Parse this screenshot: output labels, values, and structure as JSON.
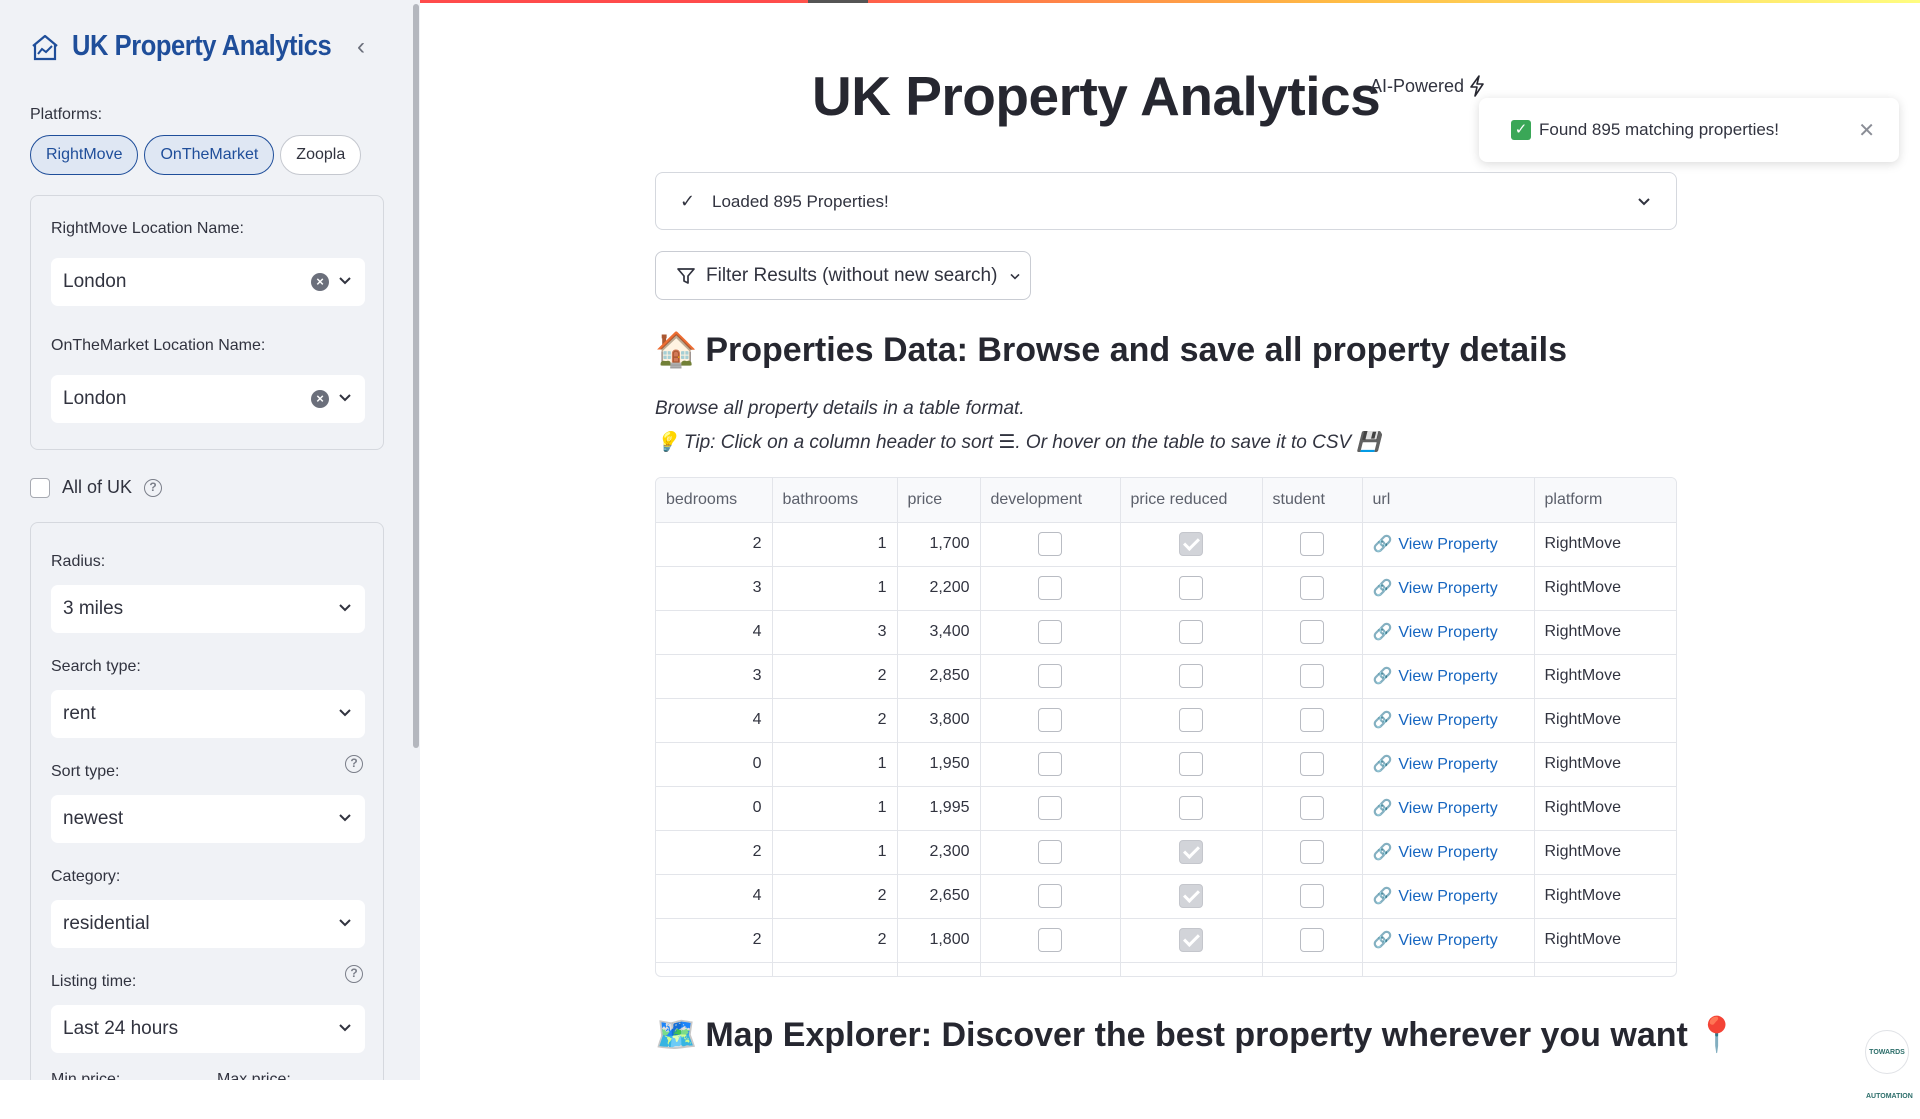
{
  "sidebar": {
    "brand_title": "UK Property Analytics",
    "platforms_label": "Platforms:",
    "platforms": [
      {
        "label": "RightMove",
        "selected": true
      },
      {
        "label": "OnTheMarket",
        "selected": true
      },
      {
        "label": "Zoopla",
        "selected": false
      }
    ],
    "rightmove_label": "RightMove Location Name:",
    "rightmove_value": "London",
    "onthemarket_label": "OnTheMarket Location Name:",
    "onthemarket_value": "London",
    "all_uk_label": "All of UK",
    "radius_label": "Radius:",
    "radius_value": "3 miles",
    "search_type_label": "Search type:",
    "search_type_value": "rent",
    "sort_type_label": "Sort type:",
    "sort_type_value": "newest",
    "category_label": "Category:",
    "category_value": "residential",
    "listing_time_label": "Listing time:",
    "listing_time_value": "Last 24 hours",
    "min_price_label": "Min price:",
    "max_price_label": "Max price:"
  },
  "header": {
    "title": "UK Property Analytics",
    "ai_powered": "AI-Powered"
  },
  "toast": {
    "message": "Found 895 matching properties!"
  },
  "expander": {
    "text": "Loaded 895 Properties!"
  },
  "filter_button": {
    "label": "Filter Results (without new search)"
  },
  "properties_section": {
    "emoji": "🏠",
    "title": "Properties Data: Browse and save all property details",
    "caption": "Browse all property details in a table format.",
    "tip": "💡 Tip: Click on a column header to sort ☰. Or hover on the table to save it to CSV 💾"
  },
  "table": {
    "columns": [
      "bedrooms",
      "bathrooms",
      "price",
      "development",
      "price reduced",
      "student",
      "url",
      "platform"
    ],
    "link_text": "View Property",
    "rows": [
      {
        "bedrooms": "2",
        "bathrooms": "1",
        "price": "1,700",
        "development": false,
        "price_reduced": true,
        "student": false,
        "platform": "RightMove"
      },
      {
        "bedrooms": "3",
        "bathrooms": "1",
        "price": "2,200",
        "development": false,
        "price_reduced": false,
        "student": false,
        "platform": "RightMove"
      },
      {
        "bedrooms": "4",
        "bathrooms": "3",
        "price": "3,400",
        "development": false,
        "price_reduced": false,
        "student": false,
        "platform": "RightMove"
      },
      {
        "bedrooms": "3",
        "bathrooms": "2",
        "price": "2,850",
        "development": false,
        "price_reduced": false,
        "student": false,
        "platform": "RightMove"
      },
      {
        "bedrooms": "4",
        "bathrooms": "2",
        "price": "3,800",
        "development": false,
        "price_reduced": false,
        "student": false,
        "platform": "RightMove"
      },
      {
        "bedrooms": "0",
        "bathrooms": "1",
        "price": "1,950",
        "development": false,
        "price_reduced": false,
        "student": false,
        "platform": "RightMove"
      },
      {
        "bedrooms": "0",
        "bathrooms": "1",
        "price": "1,995",
        "development": false,
        "price_reduced": false,
        "student": false,
        "platform": "RightMove"
      },
      {
        "bedrooms": "2",
        "bathrooms": "1",
        "price": "2,300",
        "development": false,
        "price_reduced": true,
        "student": false,
        "platform": "RightMove"
      },
      {
        "bedrooms": "4",
        "bathrooms": "2",
        "price": "2,650",
        "development": false,
        "price_reduced": true,
        "student": false,
        "platform": "RightMove"
      },
      {
        "bedrooms": "2",
        "bathrooms": "2",
        "price": "1,800",
        "development": false,
        "price_reduced": true,
        "student": false,
        "platform": "RightMove"
      }
    ]
  },
  "map_section": {
    "emoji": "🗺️",
    "title": "Map Explorer: Discover the best property wherever you want",
    "pin": "📍"
  },
  "badge": {
    "text": "TOWARDS AUTOMATION"
  },
  "colors": {
    "brand": "#1f4e9a",
    "link": "#1565c0",
    "sidebar_bg": "#f0f2f6",
    "success": "#3aa757"
  }
}
